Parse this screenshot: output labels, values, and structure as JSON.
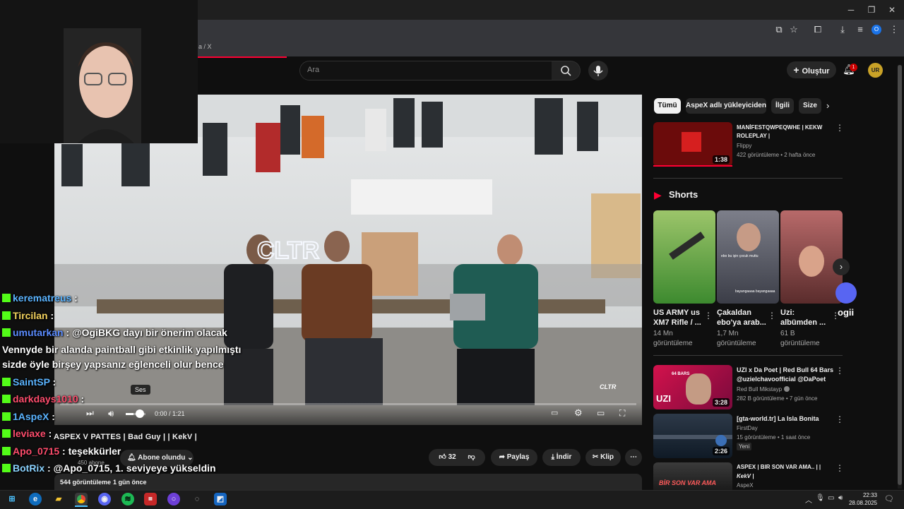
{
  "browser": {
    "tab_fragment": "a / X",
    "window_controls": {
      "minimize": "─",
      "restore": "❐",
      "close": "✕"
    },
    "profile_badge": "O"
  },
  "youtube": {
    "search_placeholder": "Ara",
    "create_label": "Oluştur",
    "notification_count": "1",
    "avatar_initials": "UR",
    "accent_color": "#ff0033"
  },
  "player": {
    "time": "0:00 / 1:21",
    "tooltip": "Ses",
    "video_overlay_text": "CLTR",
    "watermark": "CLTR",
    "volume_level": 0.4
  },
  "channel": {
    "title_line": "ASPEX V PATTES | Bad Guy | | KekV |",
    "subscribers": "450 abone",
    "subscribe_label": "Abone olundu"
  },
  "actions": {
    "likes": "32",
    "share_label": "Paylaş",
    "download_label": "İndir",
    "clip_label": "Klip"
  },
  "description": {
    "views": "544 görüntüleme",
    "date": "1 gün önce"
  },
  "chips": [
    "Tümü",
    "AspeX adlı yükleyiciden",
    "İlgili",
    "Size"
  ],
  "recommended_top": {
    "title1": "MANİFESTQWPEQWHE | KEKW",
    "title2": "ROLEPLAY |",
    "channel": "Flippy",
    "meta": "422 görüntüleme • 2 hafta önce",
    "duration": "1:38"
  },
  "shorts": {
    "header": "Shorts",
    "items": [
      {
        "title1": "US ARMY us",
        "title2": "XM7 Rifle / ...",
        "views": "14 Mn",
        "views_label": "görüntüleme"
      },
      {
        "title1": "Çakaldan",
        "title2": "ebo'ya arab...",
        "views": "1,7 Mn",
        "views_label": "görüntüleme",
        "caption": "ebo bu işin çocuk muttu",
        "caption2": "bayangaaaa bayangaaaa"
      },
      {
        "title1": "Uzi:",
        "title2": "albümden ...",
        "views": "61 B",
        "views_label": "görüntüleme"
      }
    ],
    "side_label": "ogii"
  },
  "recommended": [
    {
      "title1": "UZI x Da Poet | Red Bull 64 Bars",
      "title2": "@uzielchavoofficial @DaPoet",
      "channel": "Red Bull Mikstayp",
      "meta": "282 B görüntüleme • 7 gün önce",
      "duration": "3:28",
      "thumb_text": "UZI",
      "thumb_top": "64 BARS"
    },
    {
      "title1": "[gta-world.tr] La Isla Bonita",
      "title2": "",
      "channel": "FirstDay",
      "meta": "15 görüntüleme • 1 saat önce",
      "badge": "Yeni",
      "duration": "2:26"
    },
    {
      "title1": "ASPEX | BIR SON VAR AMA.. | |",
      "title2": "KekV |",
      "channel": "AspeX",
      "meta": "",
      "thumb_text": "BİR SON VAR AMA"
    }
  ],
  "chat": [
    {
      "user": "kerematreus",
      "color": "#5bb4ff",
      "msg": ":"
    },
    {
      "user": "Tircilan",
      "color": "#f4d35e",
      "msg": ":"
    },
    {
      "user": "umutarkan",
      "color": "#5b8cff",
      "msg": ": @OgiBKG dayı bir önerim olacak"
    },
    {
      "user": "",
      "color": "#ffffff",
      "msg": "Vennyde bir alanda paintball gibi etkinlik yapılmıştı"
    },
    {
      "user": "",
      "color": "#ffffff",
      "msg": "sizde öyle birşey yapsanız eğlenceli olur bence"
    },
    {
      "user": "SaintSP",
      "color": "#5bb4ff",
      "msg": ":"
    },
    {
      "user": "darkdays1010",
      "color": "#ff4d6d",
      "msg": ":"
    },
    {
      "user": "1AspeX",
      "color": "#5bb4ff",
      "msg": ":"
    },
    {
      "user": "leviaxe",
      "color": "#ff4d6d",
      "msg": ":"
    },
    {
      "user": "Apo_0715",
      "color": "#ff4d6d",
      "msg": ": teşekkürler"
    },
    {
      "user": "BotRix",
      "color": "#8bd3ff",
      "msg": ": @Apo_0715, 1. seviyeye yükseldin"
    }
  ],
  "taskbar": {
    "time": "22:33",
    "date": "28.08.2025"
  }
}
